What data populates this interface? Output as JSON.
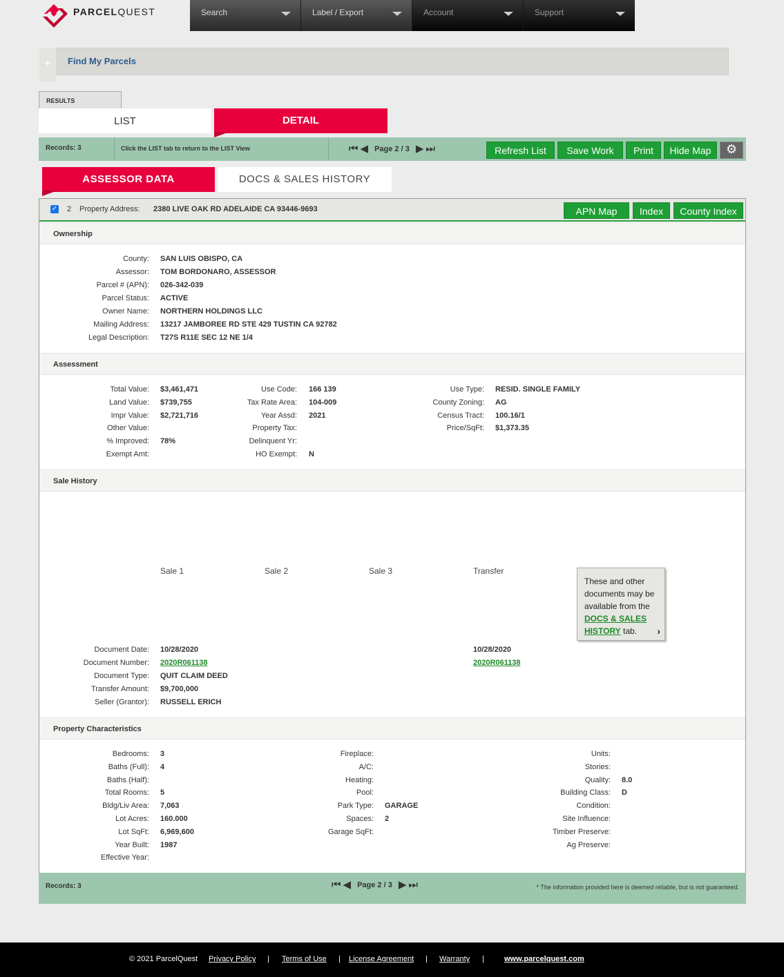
{
  "brand": {
    "name_bold": "PARCEL",
    "name_light": "QUEST"
  },
  "nav": [
    {
      "label": "Search"
    },
    {
      "label": "Label / Export"
    },
    {
      "label": "Account"
    },
    {
      "label": "Support"
    }
  ],
  "find": {
    "label": "Find My Parcels",
    "toggle": "+"
  },
  "tabs": {
    "results": "RESULTS",
    "list": "LIST",
    "detail": "DETAIL"
  },
  "toolbar": {
    "records": "Records: 3",
    "hint": "Click the LIST tab to return to the LIST View",
    "page": "Page 2 / 3",
    "refresh": "Refresh List",
    "save": "Save Work",
    "print": "Print",
    "hide_map": "Hide Map"
  },
  "subtabs": {
    "assessor": "ASSESSOR DATA",
    "docs": "DOCS & SALES HISTORY"
  },
  "property": {
    "num": "2",
    "address_label": "Property Address:",
    "address": "2380 LIVE OAK RD ADELAIDE CA 93446-9693",
    "apn_map": "APN Map",
    "index": "Index",
    "county_index": "County Index"
  },
  "ownership": {
    "title": "Ownership",
    "labels": [
      "County:",
      "Assessor:",
      "Parcel # (APN):",
      "Parcel Status:",
      "Owner Name:",
      "Mailing Address:",
      "Legal Description:"
    ],
    "values": [
      "SAN LUIS OBISPO, CA",
      "TOM BORDONARO, ASSESSOR",
      "026-342-039",
      "ACTIVE",
      "NORTHERN HOLDINGS LLC",
      "13217 JAMBOREE RD STE 429 TUSTIN CA 92782",
      "T27S R11E SEC 12 NE 1/4"
    ]
  },
  "assessment": {
    "title": "Assessment",
    "col1_labels": [
      "Total Value:",
      "Land Value:",
      "Impr Value:",
      "Other Value:",
      "% Improved:",
      "Exempt Amt:"
    ],
    "col1_values": [
      "$3,461,471",
      "$739,755",
      "$2,721,716",
      "",
      "78%",
      ""
    ],
    "col2_labels": [
      "Use Code:",
      "Tax Rate Area:",
      "Year Assd:",
      "Property Tax:",
      "Delinquent Yr:",
      "HO Exempt:"
    ],
    "col2_values": [
      "166 139",
      "104-009",
      "2021",
      "",
      "",
      "N"
    ],
    "col3_labels": [
      "Use Type:",
      "County Zoning:",
      "Census Tract:",
      "Price/SqFt:"
    ],
    "col3_values": [
      "RESID. SINGLE FAMILY",
      "AG",
      "100.16/1",
      "$1,373.35"
    ]
  },
  "sales": {
    "title": "Sale History",
    "columns": [
      "Sale 1",
      "Sale 2",
      "Sale 3",
      "Transfer"
    ],
    "labels": [
      "Document Date:",
      "Document Number:",
      "Document Type:",
      "Transfer Amount:",
      "Seller (Grantor):"
    ],
    "sale1": [
      "10/28/2020",
      "2020R061138",
      "QUIT CLAIM DEED",
      "$9,700,000",
      "RUSSELL ERICH"
    ],
    "transfer": [
      "10/28/2020",
      "2020R061138"
    ],
    "tooltip_text": "These and other documents may be available from the",
    "tooltip_link": "DOCS & SALES HISTORY",
    "tooltip_tail": "tab."
  },
  "characteristics": {
    "title": "Property Characteristics",
    "col1_labels": [
      "Bedrooms:",
      "Baths (Full):",
      "Baths (Half):",
      "Total Rooms:",
      "Bldg/Liv Area:",
      "Lot Acres:",
      "Lot SqFt:",
      "Year Built:",
      "Effective Year:"
    ],
    "col1_values": [
      "3",
      "4",
      "",
      "5",
      "7,063",
      "160.000",
      "6,969,600",
      "1987",
      ""
    ],
    "col2_labels": [
      "Fireplace:",
      "A/C:",
      "Heating:",
      "Pool:",
      "Park Type:",
      "Spaces:",
      "Garage SqFt:"
    ],
    "col2_values": [
      "",
      "",
      "",
      "",
      "GARAGE",
      "2",
      ""
    ],
    "col3_labels": [
      "Units:",
      "Stories:",
      "Quality:",
      "Building Class:",
      "Condition:",
      "Site Influence:",
      "Timber Preserve:",
      "Ag Preserve:"
    ],
    "col3_values": [
      "",
      "",
      "8.0",
      "D",
      "",
      "",
      "",
      ""
    ]
  },
  "bottom": {
    "records": "Records: 3",
    "page": "Page 2 / 3",
    "disclaimer": "* The information provided here is deemed reliable, but is not guaranteed."
  },
  "footer": {
    "copyright": "© 2021 ParcelQuest",
    "links": [
      "Privacy Policy",
      "Terms of Use",
      "License Agreement",
      "Warranty",
      "www.parcelquest.com"
    ],
    "sep": "|"
  },
  "colors": {
    "accent": "#e8003d",
    "green": "#1e9e36",
    "bar": "#9cc7ae"
  }
}
